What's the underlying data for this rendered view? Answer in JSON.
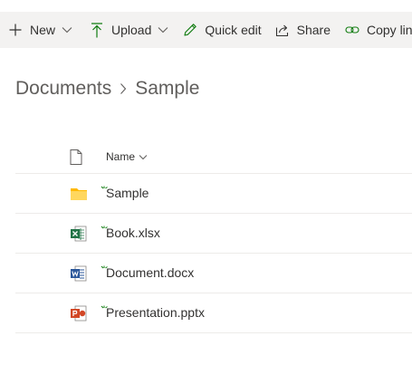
{
  "toolbar": {
    "new_label": "New",
    "upload_label": "Upload",
    "quick_edit_label": "Quick edit",
    "share_label": "Share",
    "copy_link_label": "Copy link",
    "icons": {
      "new": "plus-icon",
      "upload": "upload-arrow-icon",
      "quick_edit": "pencil-icon",
      "share": "share-icon",
      "copy_link": "link-icon"
    }
  },
  "breadcrumb": {
    "items": [
      "Documents",
      "Sample"
    ]
  },
  "list": {
    "columns": {
      "name": "Name"
    },
    "rows": [
      {
        "name": "Sample",
        "type": "folder",
        "icon": "folder-icon"
      },
      {
        "name": "Book.xlsx",
        "type": "excel",
        "icon": "excel-file-icon"
      },
      {
        "name": "Document.docx",
        "type": "word",
        "icon": "word-file-icon"
      },
      {
        "name": "Presentation.pptx",
        "type": "powerpoint",
        "icon": "powerpoint-file-icon"
      }
    ]
  },
  "colors": {
    "toolbar_bg": "#f3f2f1",
    "accent_green": "#107c10",
    "excel": "#217346",
    "word": "#2b579a",
    "powerpoint": "#d24726",
    "folder": "#ffb900"
  }
}
